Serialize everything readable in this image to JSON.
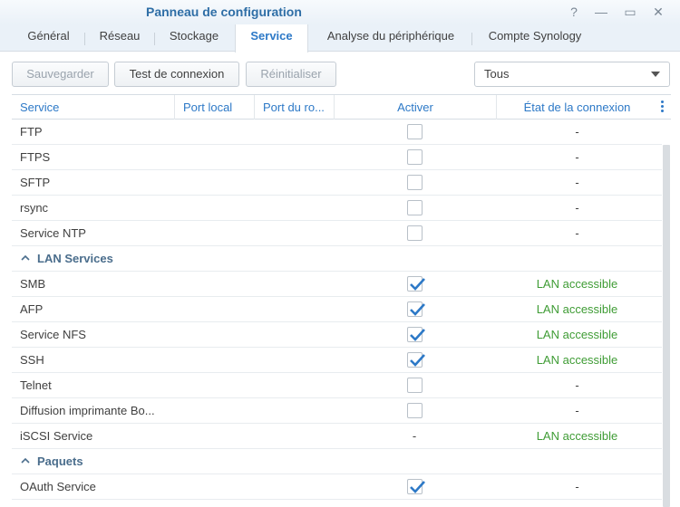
{
  "window": {
    "title": "Panneau de configuration",
    "help_label": "?",
    "min_label": "—",
    "max_label": "▭",
    "close_label": "✕"
  },
  "tabs": [
    {
      "label": "Général"
    },
    {
      "label": "Réseau"
    },
    {
      "label": "Stockage"
    },
    {
      "label": "Service"
    },
    {
      "label": "Analyse du périphérique"
    },
    {
      "label": "Compte Synology"
    }
  ],
  "toolbar": {
    "save_label": "Sauvegarder",
    "test_label": "Test de connexion",
    "reset_label": "Réinitialiser",
    "filter_value": "Tous"
  },
  "columns": {
    "service": "Service",
    "port_local": "Port local",
    "port_router": "Port du ro...",
    "activate": "Activer",
    "state": "État de la connexion"
  },
  "rows": [
    {
      "name": "FTP",
      "checked": false,
      "state": "-"
    },
    {
      "name": "FTPS",
      "checked": false,
      "state": "-"
    },
    {
      "name": "SFTP",
      "checked": false,
      "state": "-"
    },
    {
      "name": "rsync",
      "checked": false,
      "state": "-"
    },
    {
      "name": "Service NTP",
      "checked": false,
      "state": "-"
    },
    {
      "group": "LAN Services"
    },
    {
      "name": "SMB",
      "checked": true,
      "state": "LAN accessible"
    },
    {
      "name": "AFP",
      "checked": true,
      "state": "LAN accessible"
    },
    {
      "name": "Service NFS",
      "checked": true,
      "state": "LAN accessible"
    },
    {
      "name": "SSH",
      "checked": true,
      "state": "LAN accessible"
    },
    {
      "name": "Telnet",
      "checked": false,
      "state": "-"
    },
    {
      "name": "Diffusion imprimante Bo...",
      "checked": false,
      "state": "-"
    },
    {
      "name": "iSCSI Service",
      "activate_text": "-",
      "state": "LAN accessible"
    },
    {
      "group": "Paquets"
    },
    {
      "name": "OAuth Service",
      "checked": true,
      "state": "-"
    }
  ],
  "colors": {
    "accent": "#2d79c7",
    "ok": "#3f9c35",
    "group": "#4a6d8c"
  }
}
